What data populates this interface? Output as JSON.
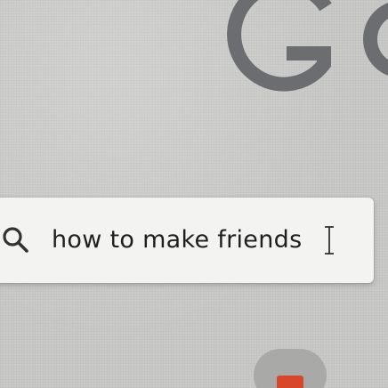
{
  "logo": {
    "text": "Go",
    "color": "#6b6d70"
  },
  "search": {
    "query": "how to make friends",
    "icon": "search-icon",
    "cursor": "text-cursor-icon",
    "background": "#f3f3f1"
  },
  "bottom_button": {
    "accent_color": "#d9472b"
  }
}
